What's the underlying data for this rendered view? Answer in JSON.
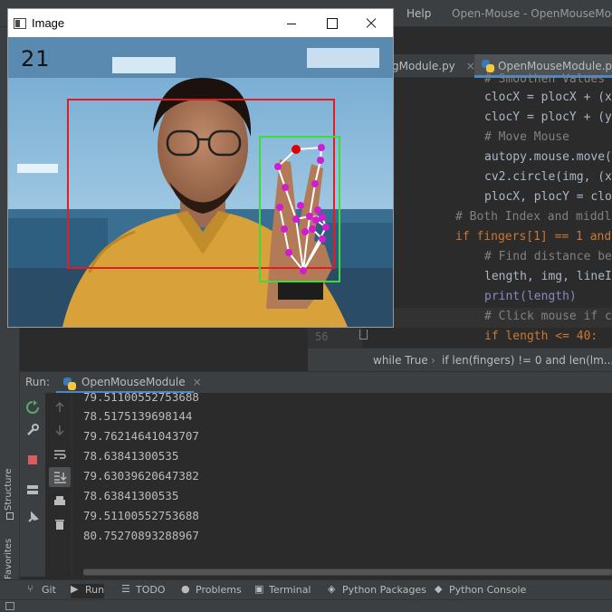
{
  "ide": {
    "menu_help": "Help",
    "window_title": "Open-Mouse - OpenMouseModu",
    "editor_tabs": [
      {
        "label": "gModule.py"
      },
      {
        "label": "OpenMouseModule.py"
      }
    ],
    "code_lines": [
      "# Smoothen Values",
      "clocX = plocX + (x",
      "clocY = plocY + (y",
      "# Move Mouse",
      "autopy.mouse.move(",
      "cv2.circle(img, (x",
      "plocX, plocY = clo",
      "# Both Index and middl",
      "if fingers[1] == 1 and",
      "# Find distance be",
      "length, img, lineI",
      "print(length)",
      "# Click mouse if c",
      "if length <= 40:"
    ],
    "line_number": "56",
    "breadcrumbs": [
      "while True",
      "if len(fingers) != 0 and len(lm..."
    ]
  },
  "run": {
    "label": "Run:",
    "tab_label": "OpenMouseModule",
    "console_lines": [
      "79.51100552753688",
      "78.5175139698144",
      "79.76214641043707",
      "78.63841300535",
      "79.63039620647382",
      "78.63841300535",
      "79.51100552753688",
      "80.75270893288967"
    ]
  },
  "side_panels": {
    "structure": "Structure",
    "favorites": "Favorites"
  },
  "bottom_tools": [
    {
      "label": "Git",
      "icon": "git-branch-icon"
    },
    {
      "label": "Run",
      "icon": "run-play-icon"
    },
    {
      "label": "TODO",
      "icon": "list-icon"
    },
    {
      "label": "Problems",
      "icon": "info-icon"
    },
    {
      "label": "Terminal",
      "icon": "terminal-icon"
    },
    {
      "label": "Python Packages",
      "icon": "layers-icon"
    },
    {
      "label": "Python Console",
      "icon": "python-icon"
    }
  ],
  "image_window": {
    "title": "Image",
    "fps": "21",
    "overlay_colors": {
      "frame_box": "#e31b23",
      "hand_box": "#3ddc3d",
      "landmark": "#d21bd2",
      "skeleton": "#ffffff",
      "pointer": "#e00000"
    }
  }
}
